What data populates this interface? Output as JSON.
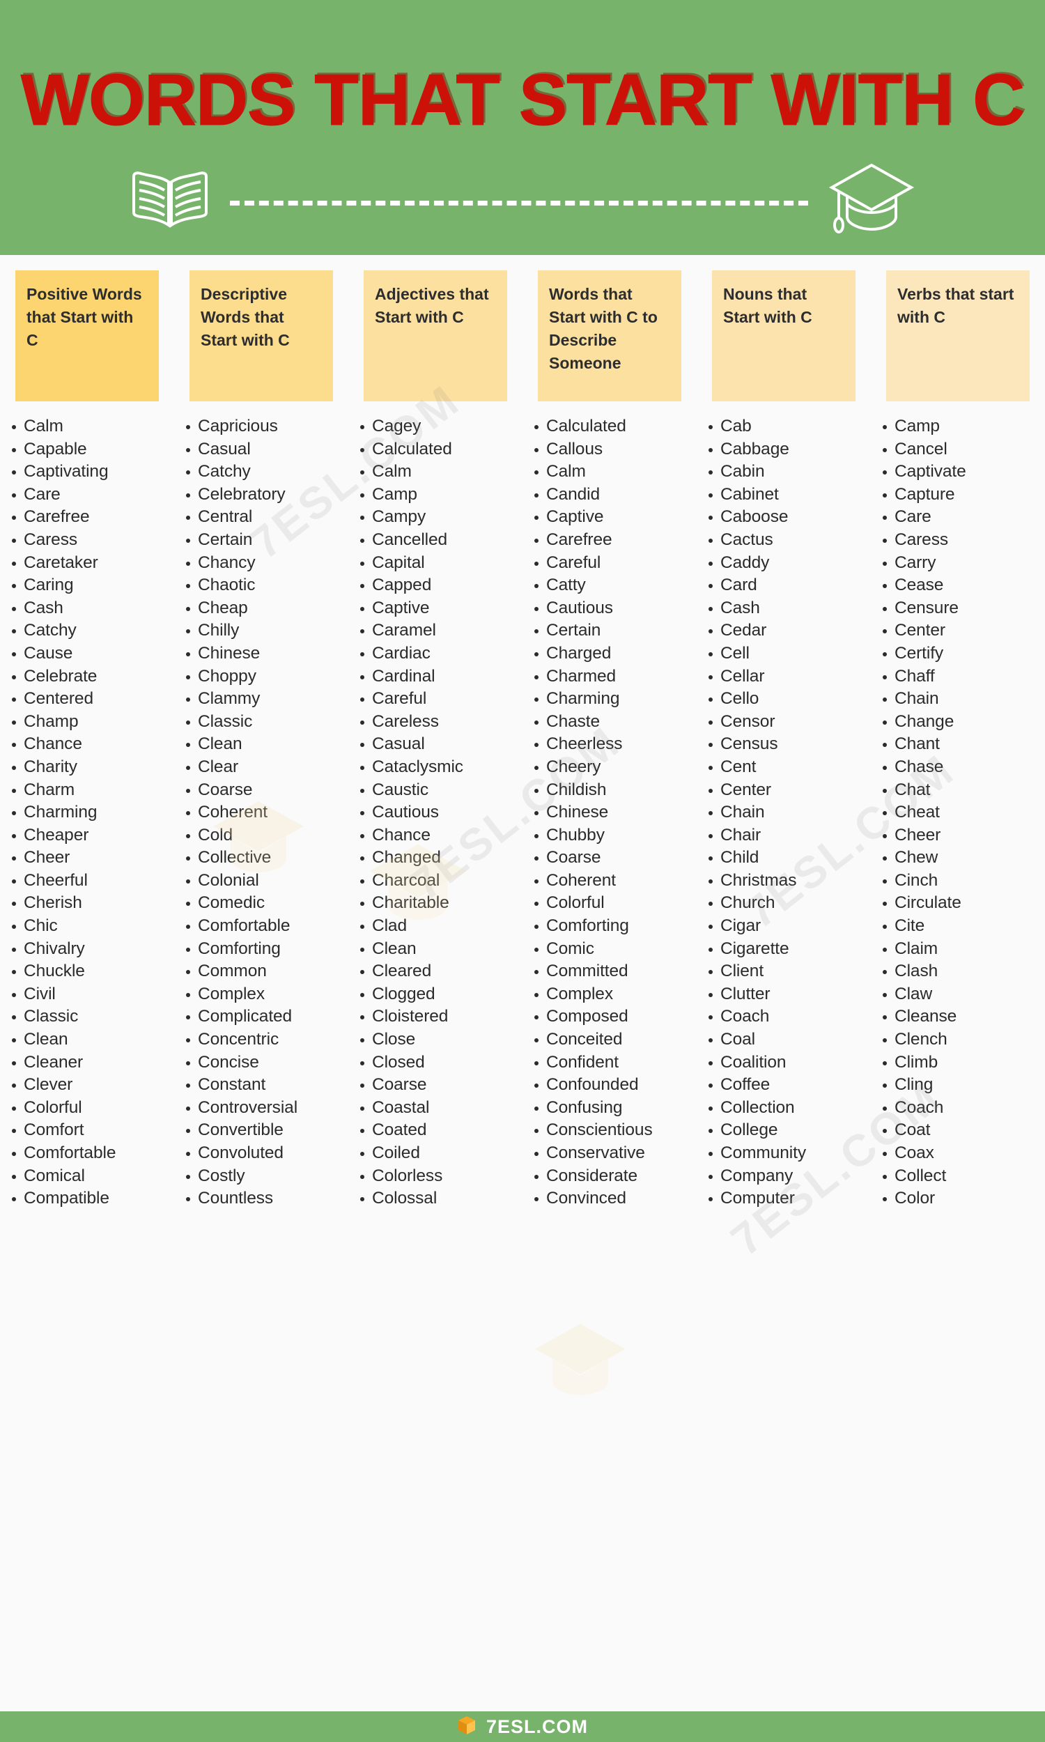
{
  "header": {
    "title": "WORDS THAT START WITH C",
    "left_icon": "open-book-icon",
    "right_icon": "graduation-cap-icon",
    "background_color": "#77b36a",
    "title_color": "#cc1208"
  },
  "footer": {
    "brand": "7ESL.COM",
    "logo_icon": "7esl-logo-icon",
    "background_color": "#77b36a"
  },
  "watermark": {
    "text": "7ESL.COM"
  },
  "columns": [
    {
      "id": "positive-words",
      "header": "Positive Words that Start with C",
      "header_color": "#fcd570",
      "words": [
        "Calm",
        "Capable",
        "Captivating",
        "Care",
        "Carefree",
        "Caress",
        "Caretaker",
        "Caring",
        "Cash",
        "Catchy",
        "Cause",
        "Celebrate",
        "Centered",
        "Champ",
        "Chance",
        "Charity",
        "Charm",
        "Charming",
        "Cheaper",
        "Cheer",
        "Cheerful",
        "Cherish",
        "Chic",
        "Chivalry",
        "Chuckle",
        "Civil",
        "Classic",
        "Clean",
        "Cleaner",
        "Clever",
        "Colorful",
        "Comfort",
        "Comfortable",
        "Comical",
        "Compatible"
      ]
    },
    {
      "id": "descriptive-words",
      "header": "Descriptive Words that Start with C",
      "header_color": "#fcdc8d",
      "words": [
        "Capricious",
        "Casual",
        "Catchy",
        "Celebratory",
        "Central",
        "Certain",
        "Chancy",
        "Chaotic",
        "Cheap",
        "Chilly",
        "Chinese",
        "Choppy",
        "Clammy",
        "Classic",
        "Clean",
        "Clear",
        "Coarse",
        "Coherent",
        "Cold",
        "Collective",
        "Colonial",
        "Comedic",
        "Comfortable",
        "Comforting",
        "Common",
        "Complex",
        "Complicated",
        "Concentric",
        "Concise",
        "Constant",
        "Controversial",
        "Convertible",
        "Convoluted",
        "Costly",
        "Countless"
      ]
    },
    {
      "id": "adjectives",
      "header": "Adjectives that Start with C",
      "header_color": "#fce0a0",
      "words": [
        "Cagey",
        "Calculated",
        "Calm",
        "Camp",
        "Campy",
        "Cancelled",
        "Capital",
        "Capped",
        "Captive",
        "Caramel",
        "Cardiac",
        "Cardinal",
        "Careful",
        "Careless",
        "Casual",
        "Cataclysmic",
        "Caustic",
        "Cautious",
        "Chance",
        "Changed",
        "Charcoal",
        "Charitable",
        "Clad",
        "Clean",
        "Cleared",
        "Clogged",
        "Cloistered",
        "Close",
        "Closed",
        "Coarse",
        "Coastal",
        "Coated",
        "Coiled",
        "Colorless",
        "Colossal"
      ]
    },
    {
      "id": "describe-someone",
      "header": "Words that Start with C to Describe Someone",
      "header_color": "#fce0a0",
      "words": [
        "Calculated",
        "Callous",
        "Calm",
        "Candid",
        "Captive",
        "Carefree",
        "Careful",
        "Catty",
        "Cautious",
        "Certain",
        "Charged",
        "Charmed",
        "Charming",
        "Chaste",
        "Cheerless",
        "Cheery",
        "Childish",
        "Chinese",
        "Chubby",
        "Coarse",
        "Coherent",
        "Colorful",
        "Comforting",
        "Comic",
        "Committed",
        "Complex",
        "Composed",
        "Conceited",
        "Confident",
        "Confounded",
        "Confusing",
        "Conscientious",
        "Conservative",
        "Considerate",
        "Convinced"
      ]
    },
    {
      "id": "nouns",
      "header": "Nouns that Start with C",
      "header_color": "#fce3ae",
      "words": [
        "Cab",
        "Cabbage",
        "Cabin",
        "Cabinet",
        "Caboose",
        "Cactus",
        "Caddy",
        "Card",
        "Cash",
        "Cedar",
        "Cell",
        "Cellar",
        "Cello",
        "Censor",
        "Census",
        "Cent",
        "Center",
        "Chain",
        "Chair",
        "Child",
        "Christmas",
        "Church",
        "Cigar",
        "Cigarette",
        "Client",
        "Clutter",
        "Coach",
        "Coal",
        "Coalition",
        "Coffee",
        "Collection",
        "College",
        "Community",
        "Company",
        "Computer"
      ]
    },
    {
      "id": "verbs",
      "header": "Verbs that start with C",
      "header_color": "#fce7bc",
      "words": [
        "Camp",
        "Cancel",
        "Captivate",
        "Capture",
        "Care",
        "Caress",
        "Carry",
        "Cease",
        "Censure",
        "Center",
        "Certify",
        "Chaff",
        "Chain",
        "Change",
        "Chant",
        "Chase",
        "Chat",
        "Cheat",
        "Cheer",
        "Chew",
        "Cinch",
        "Circulate",
        "Cite",
        "Claim",
        "Clash",
        "Claw",
        "Cleanse",
        "Clench",
        "Climb",
        "Cling",
        "Coach",
        "Coat",
        "Coax",
        "Collect",
        "Color"
      ]
    }
  ]
}
